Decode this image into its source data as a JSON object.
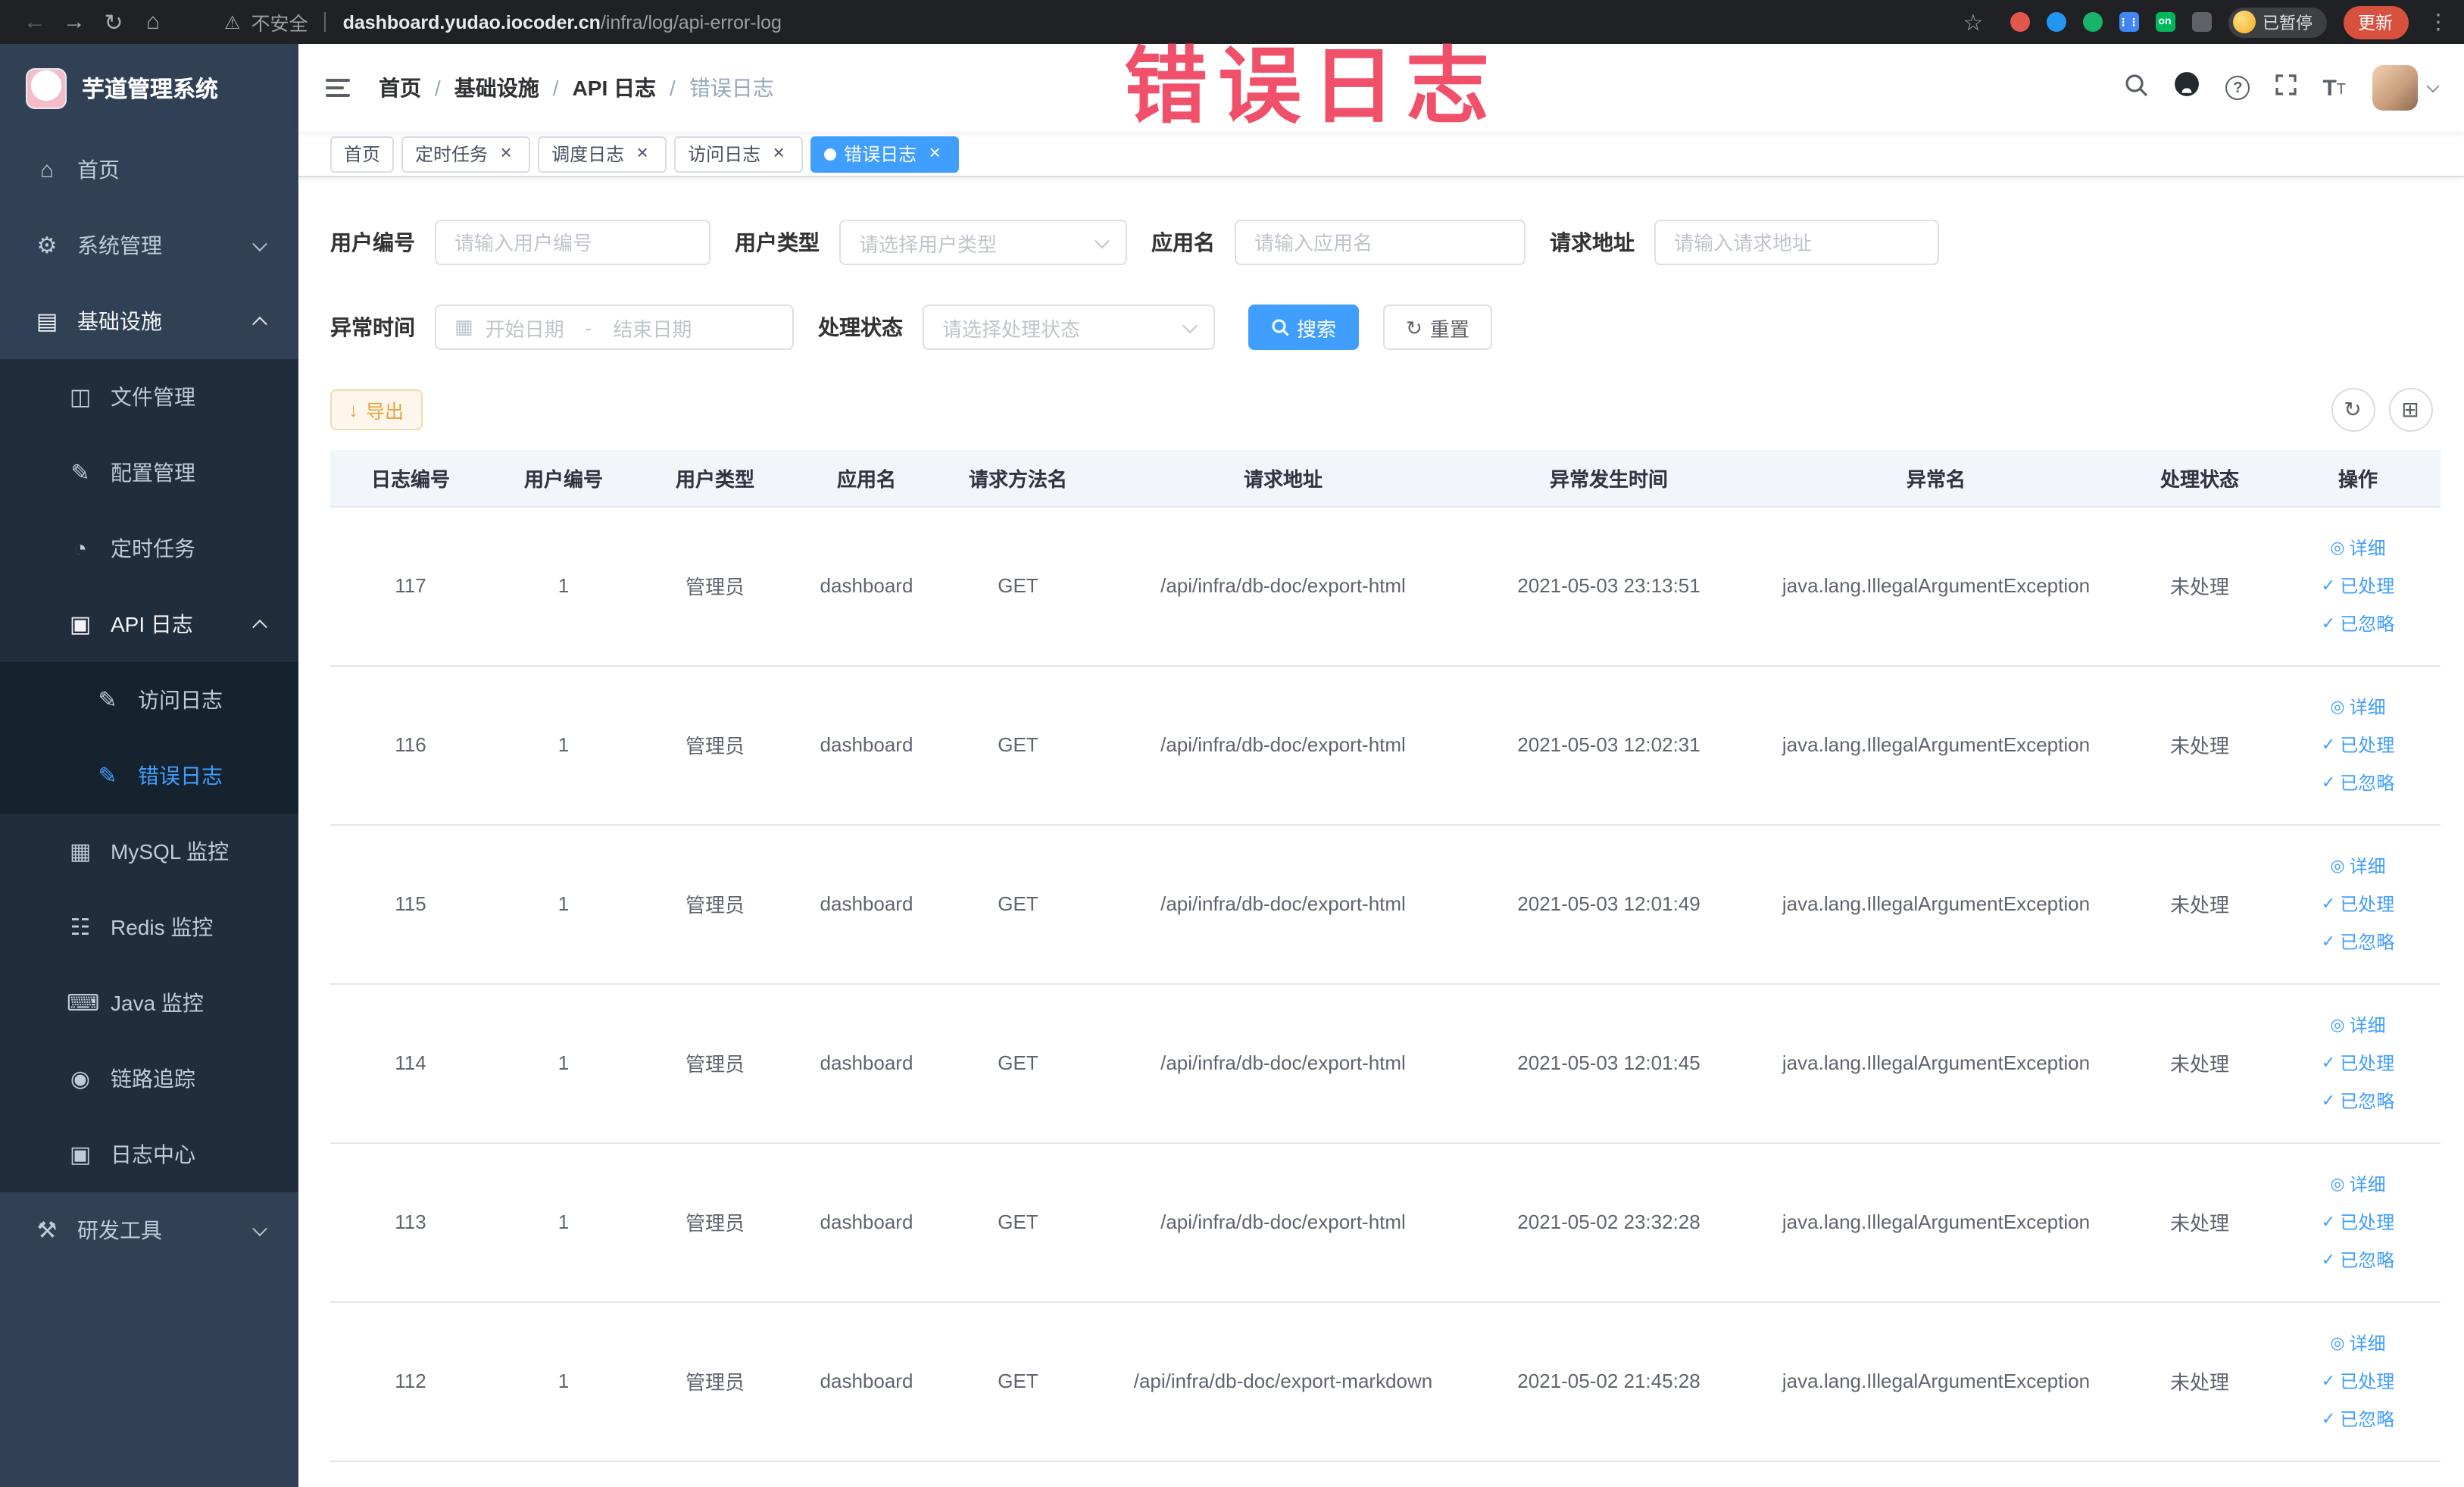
{
  "colors": {
    "accent": "#409eff",
    "warning": "#e6a23c",
    "annotation": "#f03e5a"
  },
  "browser": {
    "security_text": "不安全",
    "url_domain": "dashboard.yudao.iocoder.cn",
    "url_path": "/infra/log/api-error-log",
    "paused_label": "已暂停",
    "update_label": "更新"
  },
  "overlay": {
    "text": "错误日志"
  },
  "sidebar": {
    "app_title": "芋道管理系统",
    "items": [
      {
        "label": "首页",
        "depth": 0,
        "icon": "dashboard-icon"
      },
      {
        "label": "系统管理",
        "depth": 0,
        "icon": "gear-icon",
        "arrow": "down"
      },
      {
        "label": "基础设施",
        "depth": 0,
        "icon": "infra-icon",
        "arrow": "up",
        "open": true
      },
      {
        "label": "文件管理",
        "depth": 1,
        "icon": "file-icon"
      },
      {
        "label": "配置管理",
        "depth": 1,
        "icon": "edit-icon"
      },
      {
        "label": "定时任务",
        "depth": 1,
        "icon": "job-icon"
      },
      {
        "label": "API 日志",
        "depth": 1,
        "icon": "log-icon",
        "arrow": "up",
        "open": true
      },
      {
        "label": "访问日志",
        "depth": 2,
        "icon": "edit-square-icon"
      },
      {
        "label": "错误日志",
        "depth": 2,
        "icon": "edit-square-icon",
        "active": true
      },
      {
        "label": "MySQL 监控",
        "depth": 1,
        "icon": "mysql-icon"
      },
      {
        "label": "Redis 监控",
        "depth": 1,
        "icon": "redis-icon"
      },
      {
        "label": "Java 监控",
        "depth": 1,
        "icon": "java-icon"
      },
      {
        "label": "链路追踪",
        "depth": 1,
        "icon": "trace-icon"
      },
      {
        "label": "日志中心",
        "depth": 1,
        "icon": "log-center-icon"
      },
      {
        "label": "研发工具",
        "depth": 0,
        "icon": "tool-icon",
        "arrow": "down"
      }
    ]
  },
  "header": {
    "breadcrumb": [
      "首页",
      "基础设施",
      "API 日志",
      "错误日志"
    ]
  },
  "tabs": [
    {
      "label": "首页",
      "closable": false,
      "active": false
    },
    {
      "label": "定时任务",
      "closable": true,
      "active": false
    },
    {
      "label": "调度日志",
      "closable": true,
      "active": false
    },
    {
      "label": "访问日志",
      "closable": true,
      "active": false
    },
    {
      "label": "错误日志",
      "closable": true,
      "active": true
    }
  ],
  "filters": {
    "user_id": {
      "label": "用户编号",
      "placeholder": "请输入用户编号"
    },
    "user_type": {
      "label": "用户类型",
      "placeholder": "请选择用户类型"
    },
    "app_name": {
      "label": "应用名",
      "placeholder": "请输入应用名"
    },
    "request_url": {
      "label": "请求地址",
      "placeholder": "请输入请求地址"
    },
    "time": {
      "label": "异常时间",
      "start_placeholder": "开始日期",
      "separator": "-",
      "end_placeholder": "结束日期"
    },
    "status": {
      "label": "处理状态",
      "placeholder": "请选择处理状态"
    },
    "search_label": "搜索",
    "reset_label": "重置"
  },
  "toolbar": {
    "export_label": "导出"
  },
  "table": {
    "columns": [
      "日志编号",
      "用户编号",
      "用户类型",
      "应用名",
      "请求方法名",
      "请求地址",
      "异常发生时间",
      "异常名",
      "处理状态",
      "操作"
    ],
    "actions": [
      {
        "label": "详细",
        "icon": "view-icon"
      },
      {
        "label": "已处理",
        "icon": "check-icon"
      },
      {
        "label": "已忽略",
        "icon": "check-icon"
      }
    ],
    "rows": [
      {
        "id": "117",
        "user_id": "1",
        "user_type": "管理员",
        "app": "dashboard",
        "method": "GET",
        "url": "/api/infra/db-doc/export-html",
        "time": "2021-05-03 23:13:51",
        "exception": "java.lang.IllegalArgumentException",
        "status": "未处理"
      },
      {
        "id": "116",
        "user_id": "1",
        "user_type": "管理员",
        "app": "dashboard",
        "method": "GET",
        "url": "/api/infra/db-doc/export-html",
        "time": "2021-05-03 12:02:31",
        "exception": "java.lang.IllegalArgumentException",
        "status": "未处理"
      },
      {
        "id": "115",
        "user_id": "1",
        "user_type": "管理员",
        "app": "dashboard",
        "method": "GET",
        "url": "/api/infra/db-doc/export-html",
        "time": "2021-05-03 12:01:49",
        "exception": "java.lang.IllegalArgumentException",
        "status": "未处理"
      },
      {
        "id": "114",
        "user_id": "1",
        "user_type": "管理员",
        "app": "dashboard",
        "method": "GET",
        "url": "/api/infra/db-doc/export-html",
        "time": "2021-05-03 12:01:45",
        "exception": "java.lang.IllegalArgumentException",
        "status": "未处理"
      },
      {
        "id": "113",
        "user_id": "1",
        "user_type": "管理员",
        "app": "dashboard",
        "method": "GET",
        "url": "/api/infra/db-doc/export-html",
        "time": "2021-05-02 23:32:28",
        "exception": "java.lang.IllegalArgumentException",
        "status": "未处理"
      },
      {
        "id": "112",
        "user_id": "1",
        "user_type": "管理员",
        "app": "dashboard",
        "method": "GET",
        "url": "/api/infra/db-doc/export-markdown",
        "time": "2021-05-02 21:45:28",
        "exception": "java.lang.IllegalArgumentException",
        "status": "未处理"
      }
    ]
  }
}
